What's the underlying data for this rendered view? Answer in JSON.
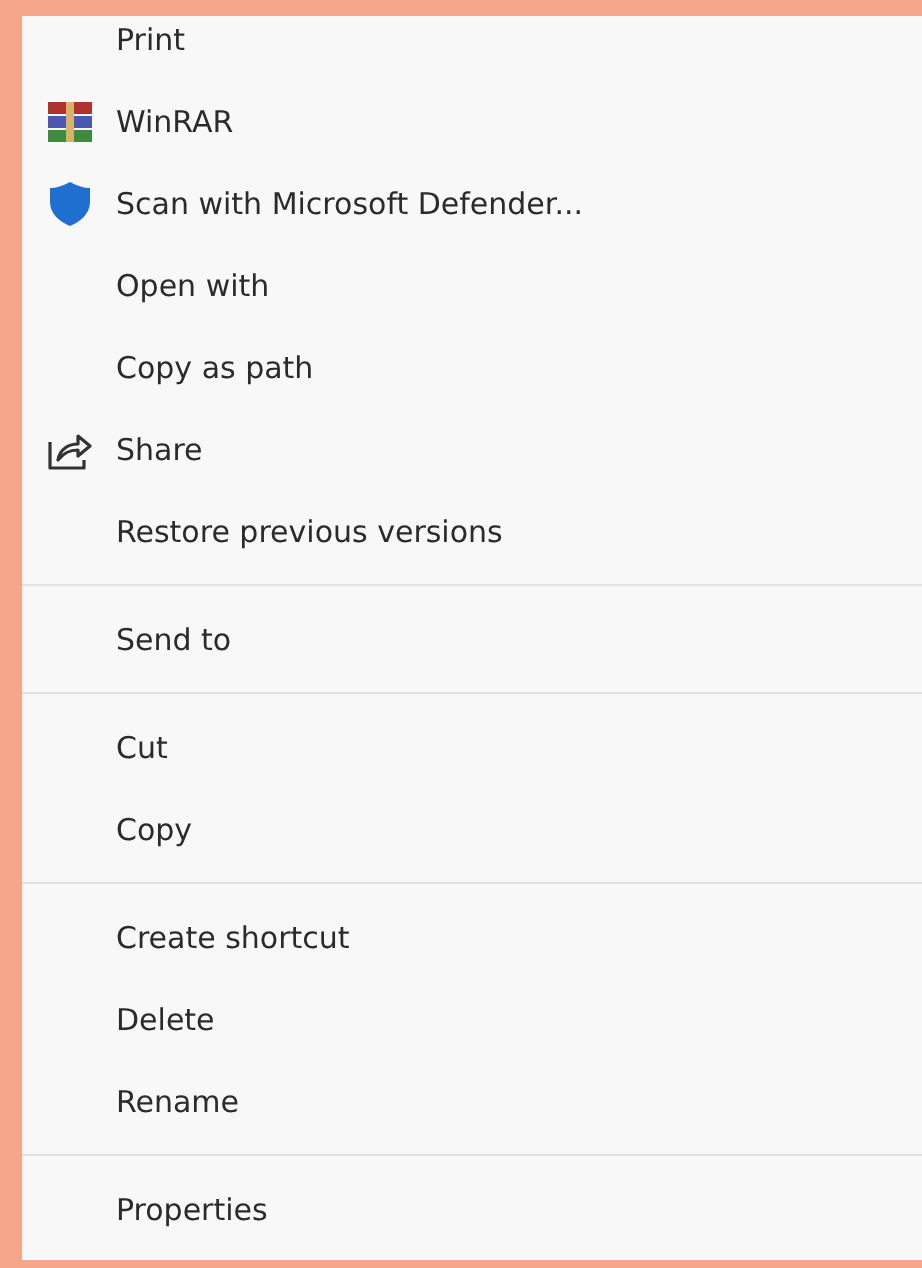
{
  "menu": {
    "groups": [
      {
        "items": [
          {
            "label": "Print",
            "kind": "plain"
          },
          {
            "label": "WinRAR",
            "kind": "books"
          },
          {
            "label": "Scan with Microsoft Defender...",
            "kind": "shield"
          },
          {
            "label": "Open with",
            "kind": "plain"
          },
          {
            "label": "Copy as path",
            "kind": "plain"
          },
          {
            "label": "Share",
            "kind": "share"
          },
          {
            "label": "Restore previous versions",
            "kind": "plain"
          }
        ]
      },
      {
        "items": [
          {
            "label": "Send to",
            "kind": "plain"
          }
        ]
      },
      {
        "items": [
          {
            "label": "Cut",
            "kind": "plain"
          },
          {
            "label": "Copy",
            "kind": "plain"
          }
        ]
      },
      {
        "items": [
          {
            "label": "Create shortcut",
            "kind": "plain"
          },
          {
            "label": "Delete",
            "kind": "plain"
          },
          {
            "label": "Rename",
            "kind": "plain"
          }
        ]
      },
      {
        "items": [
          {
            "label": "Properties",
            "kind": "plain"
          }
        ]
      }
    ]
  }
}
